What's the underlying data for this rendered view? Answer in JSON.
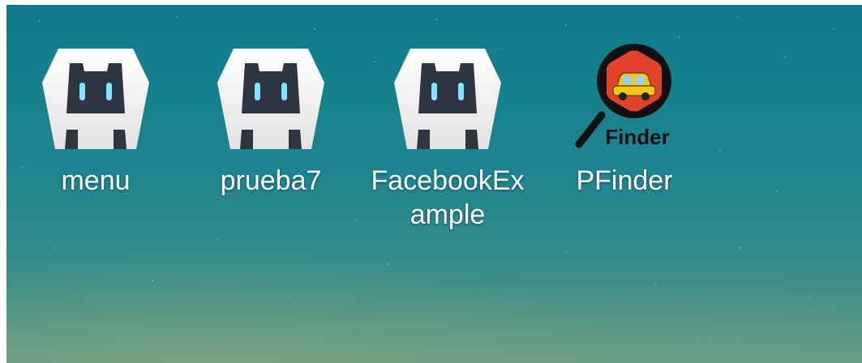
{
  "desktop": {
    "icons": [
      {
        "label": "menu",
        "icon": "cordova-icon"
      },
      {
        "label": "prueba7",
        "icon": "cordova-icon"
      },
      {
        "label": "FacebookEx\nample",
        "icon": "cordova-icon"
      },
      {
        "label": "PFinder",
        "icon": "pfinder-magnifier-car-icon",
        "badge_text": "Finder"
      }
    ]
  },
  "colors": {
    "background_top": "#0f7b8a",
    "background_bottom": "#6a9b86",
    "icon_body": "#f4f4f4",
    "icon_face": "#2d3540",
    "icon_eye": "#7fe6ff",
    "pfinder_hex": "#e4412c",
    "pfinder_car": "#f5c518"
  }
}
